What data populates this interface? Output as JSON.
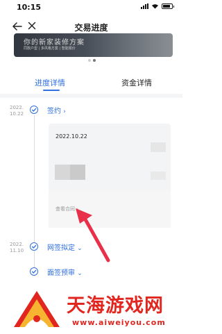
{
  "status_bar": {
    "time": "10:15"
  },
  "header": {
    "title": "交易进度"
  },
  "banner": {
    "main_text": "你的新家装修方案",
    "sub_text": "同款户型 | 多风格方案 | 智能报价"
  },
  "tabs": [
    {
      "label": "进度详情",
      "active": true
    },
    {
      "label": "资金详情",
      "active": false
    }
  ],
  "timeline": [
    {
      "date_line1": "2022.",
      "date_line2": "10.22",
      "step": "签约",
      "chevron": "›"
    },
    {
      "date_line1": "2022.",
      "date_line2": "11.10",
      "step": "网签拟定",
      "chevron": "⌄"
    },
    {
      "date_line1": "",
      "date_line2": "",
      "step": "面签预审",
      "chevron": "⌄"
    }
  ],
  "card": {
    "date": "2022.10.22",
    "link": "查看合同 ›"
  },
  "colors": {
    "accent": "#2f6fe0",
    "arrow": "#e8304a",
    "watermark": "#e0261f"
  },
  "watermark": {
    "text": "天海游戏网",
    "url": "www.aiweiyou.com"
  }
}
